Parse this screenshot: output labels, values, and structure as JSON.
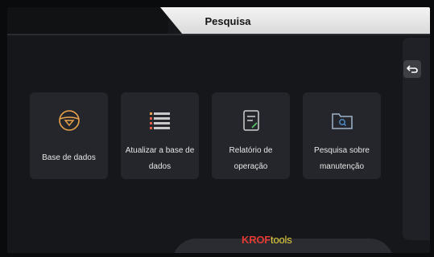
{
  "header": {
    "title": "Pesquisa"
  },
  "side_panel": {
    "back_icon": "back-arrow-icon"
  },
  "cards": [
    {
      "label": "Base de dados",
      "icon": "steering-wheel-icon"
    },
    {
      "label": "Atualizar a base de dados",
      "icon": "list-icon"
    },
    {
      "label": "Relatório de operação",
      "icon": "report-icon"
    },
    {
      "label": "Pesquisa sobre manutenção",
      "icon": "folder-search-icon"
    }
  ],
  "footer": {
    "brand_part1": "KROF",
    "brand_part2": "tools"
  },
  "colors": {
    "accent": "#e8a24a",
    "background": "#16171b",
    "card": "#25262b"
  }
}
